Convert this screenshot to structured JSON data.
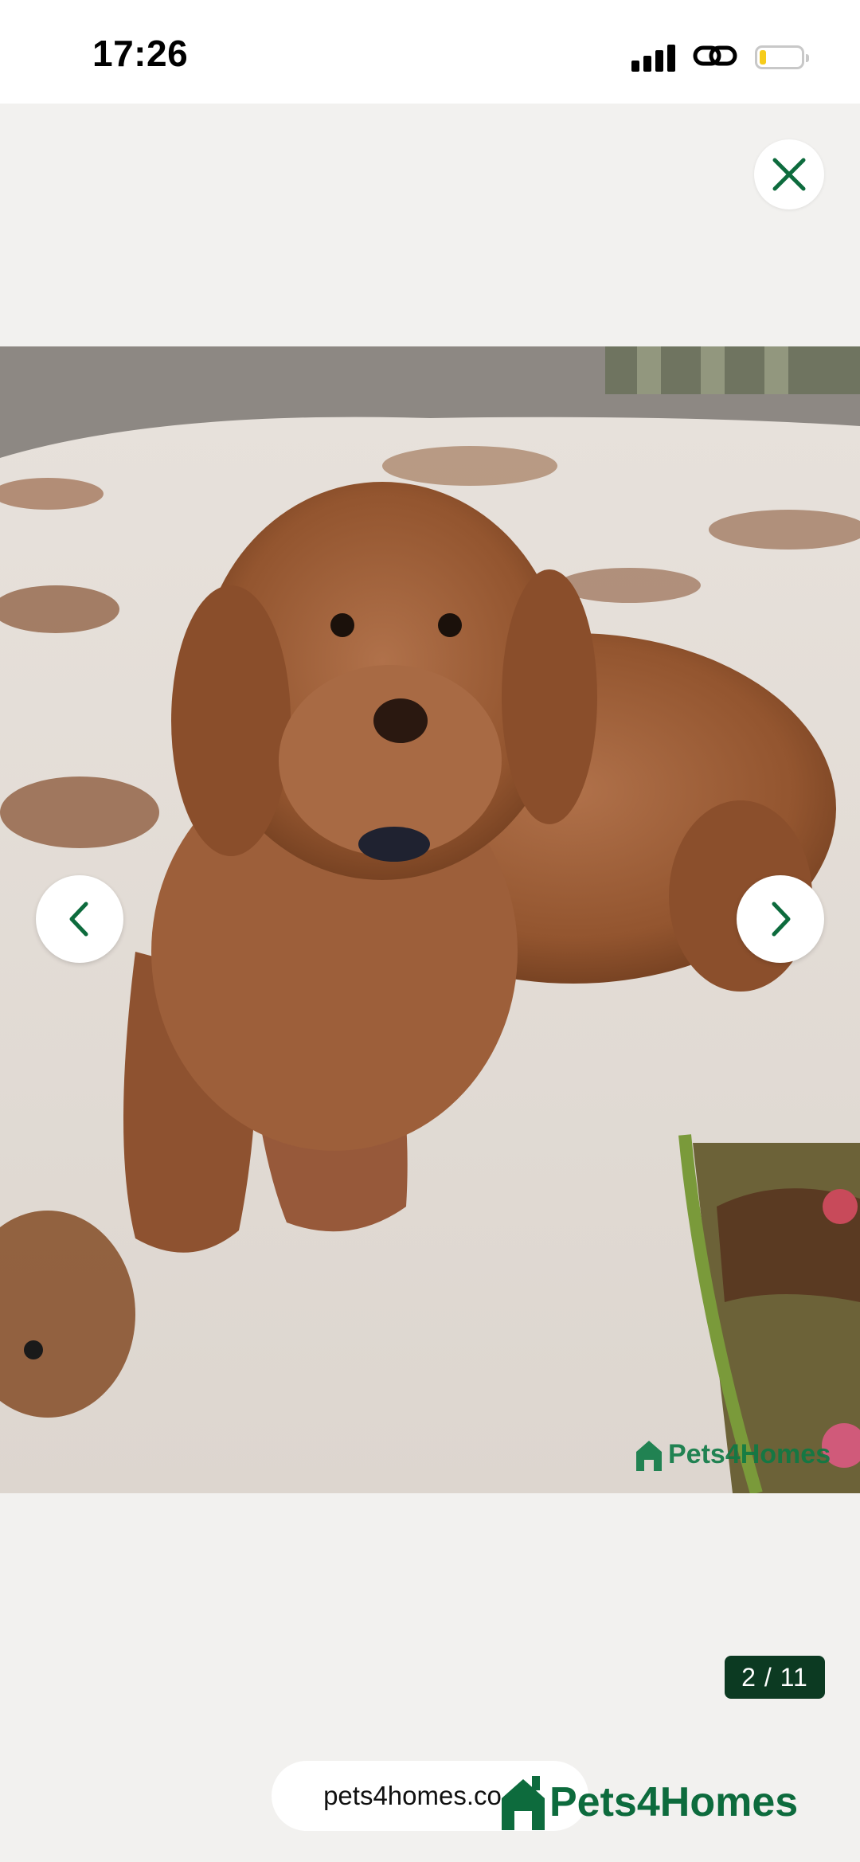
{
  "status_bar": {
    "time": "17:26",
    "icons": [
      "cellular-signal-icon",
      "link-icon",
      "battery-icon"
    ],
    "battery_level": 0.15
  },
  "viewer": {
    "close_icon": "close-icon",
    "prev_icon": "chevron-left-icon",
    "next_icon": "chevron-right-icon",
    "watermark_text": "Pets4Homes",
    "counter_text": "2 / 11"
  },
  "browser": {
    "url": "pets4homes.co.uk"
  },
  "brand": {
    "name": "Pets4Homes",
    "logo_icon": "pets4homes-house-icon"
  },
  "colors": {
    "brand_green": "#0d6b3d",
    "counter_bg": "#0c3a22",
    "page_bg": "#f2f1ef"
  }
}
